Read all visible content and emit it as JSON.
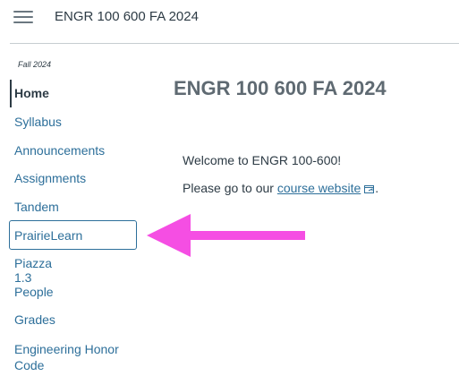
{
  "header": {
    "course_title": "ENGR 100 600 FA 2024",
    "menu_icon": "hamburger-icon"
  },
  "sidebar": {
    "term": "Fall 2024",
    "items": [
      {
        "label": "Home",
        "active": true
      },
      {
        "label": "Syllabus"
      },
      {
        "label": "Announcements"
      },
      {
        "label": "Assignments"
      },
      {
        "label": "Tandem"
      },
      {
        "label": "PrairieLearn",
        "highlighted": true
      },
      {
        "label": "Piazza 1.3"
      },
      {
        "label": "People"
      },
      {
        "label": "Grades"
      },
      {
        "label": "Engineering Honor Code"
      }
    ]
  },
  "main": {
    "title": "ENGR 100 600 FA 2024",
    "welcome": "Welcome to ENGR 100-600!",
    "goto_prefix": "Please go to our ",
    "link_text": "course website",
    "goto_suffix": ".",
    "link_icon": "external-link-icon"
  },
  "annotation": {
    "icon": "arrow-left-icon",
    "color": "#f54ee3"
  },
  "colors": {
    "link": "#2d6f9a",
    "text": "#2d3b45",
    "title": "#5f6a72"
  }
}
